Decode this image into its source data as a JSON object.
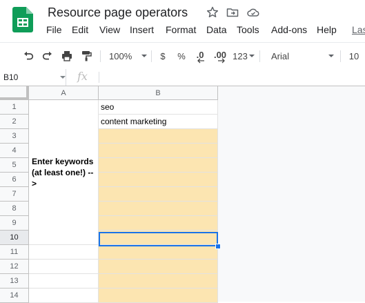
{
  "app": {
    "title": "Resource page operators",
    "icons": [
      "sheets-logo-icon",
      "star-icon",
      "move-folder-icon",
      "cloud-status-icon"
    ]
  },
  "menu": [
    "File",
    "Edit",
    "View",
    "Insert",
    "Format",
    "Data",
    "Tools",
    "Add-ons",
    "Help",
    "Las"
  ],
  "toolbar": {
    "zoom": "100%",
    "currency": "$",
    "percent": "%",
    "decrease_decimal": ".0",
    "increase_decimal": ".00",
    "more_formats": "123",
    "font": "Arial",
    "font_size": "10"
  },
  "formula_bar": {
    "cell_ref": "B10",
    "fx": "fx",
    "value": ""
  },
  "grid": {
    "columns": [
      "A",
      "B"
    ],
    "rows": [
      "1",
      "2",
      "3",
      "4",
      "5",
      "6",
      "7",
      "8",
      "9",
      "10",
      "11",
      "12",
      "13",
      "14"
    ],
    "active_row": "10",
    "merged_a_text": "Enter keywords (at least one!) -->",
    "b_values": [
      "seo",
      "content marketing",
      "",
      "",
      "",
      "",
      "",
      "",
      "",
      "",
      "",
      "",
      "",
      ""
    ],
    "input_fill_color": "#fce5b1",
    "selection_color": "#1a73e8"
  }
}
